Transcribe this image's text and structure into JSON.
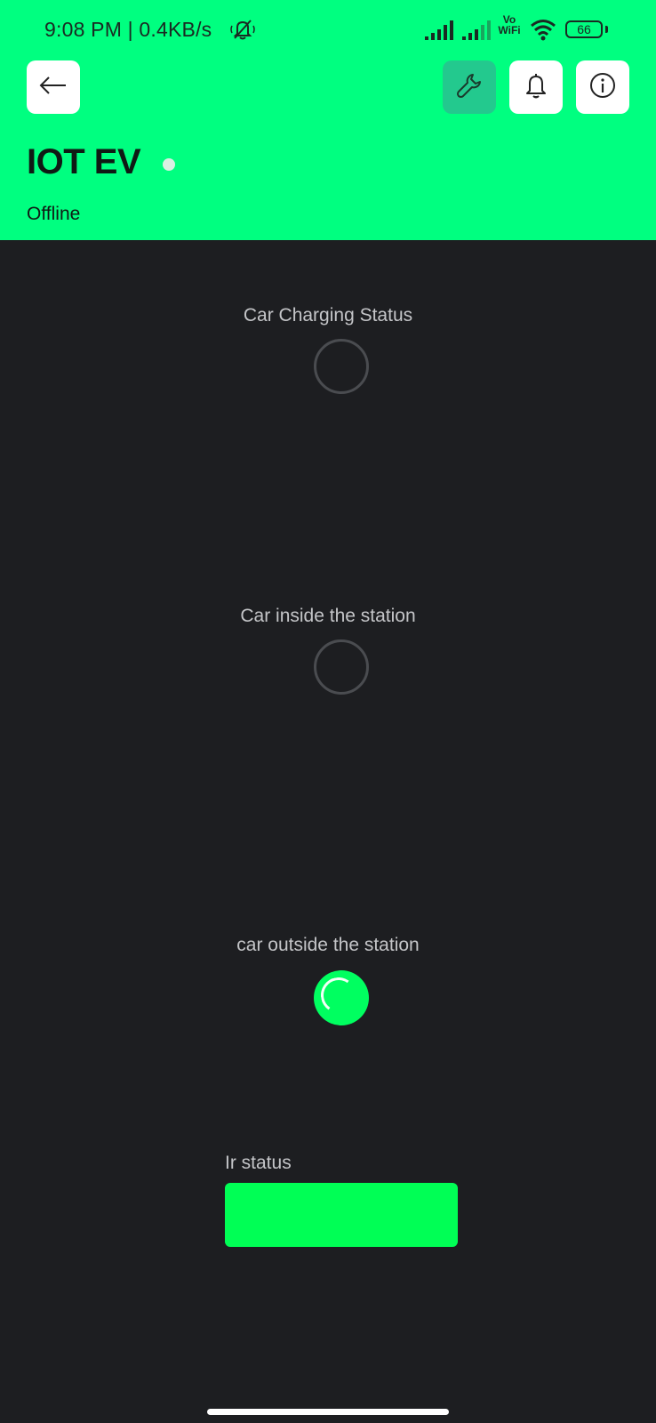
{
  "status_bar": {
    "time_speed": "9:08 PM | 0.4KB/s",
    "vowifi_line1": "Vo",
    "vowifi_line2": "WiFi",
    "battery_level": "66",
    "icons": [
      "mute-alarm-icon",
      "signal-icon",
      "signal-icon",
      "wifi-icon",
      "battery-icon"
    ]
  },
  "header": {
    "background_color": "#00ff80",
    "buttons": [
      {
        "name": "back-button",
        "icon": "arrow-left-icon"
      },
      {
        "name": "settings-button",
        "icon": "wrench-icon",
        "active_color": "#23c98e"
      },
      {
        "name": "notifications-button",
        "icon": "bell-icon"
      },
      {
        "name": "info-button",
        "icon": "info-icon"
      }
    ],
    "device_title": "IOT EV",
    "device_status": "Offline"
  },
  "widgets": [
    {
      "label": "Car Charging Status",
      "type": "led",
      "state": "off"
    },
    {
      "label": "Car inside the station",
      "type": "led",
      "state": "off"
    },
    {
      "label": "car outside the station",
      "type": "led",
      "state": "on",
      "color": "#00ff60"
    },
    {
      "label": "Ir status",
      "type": "bar",
      "state": "on",
      "color": "#00ff55"
    }
  ]
}
